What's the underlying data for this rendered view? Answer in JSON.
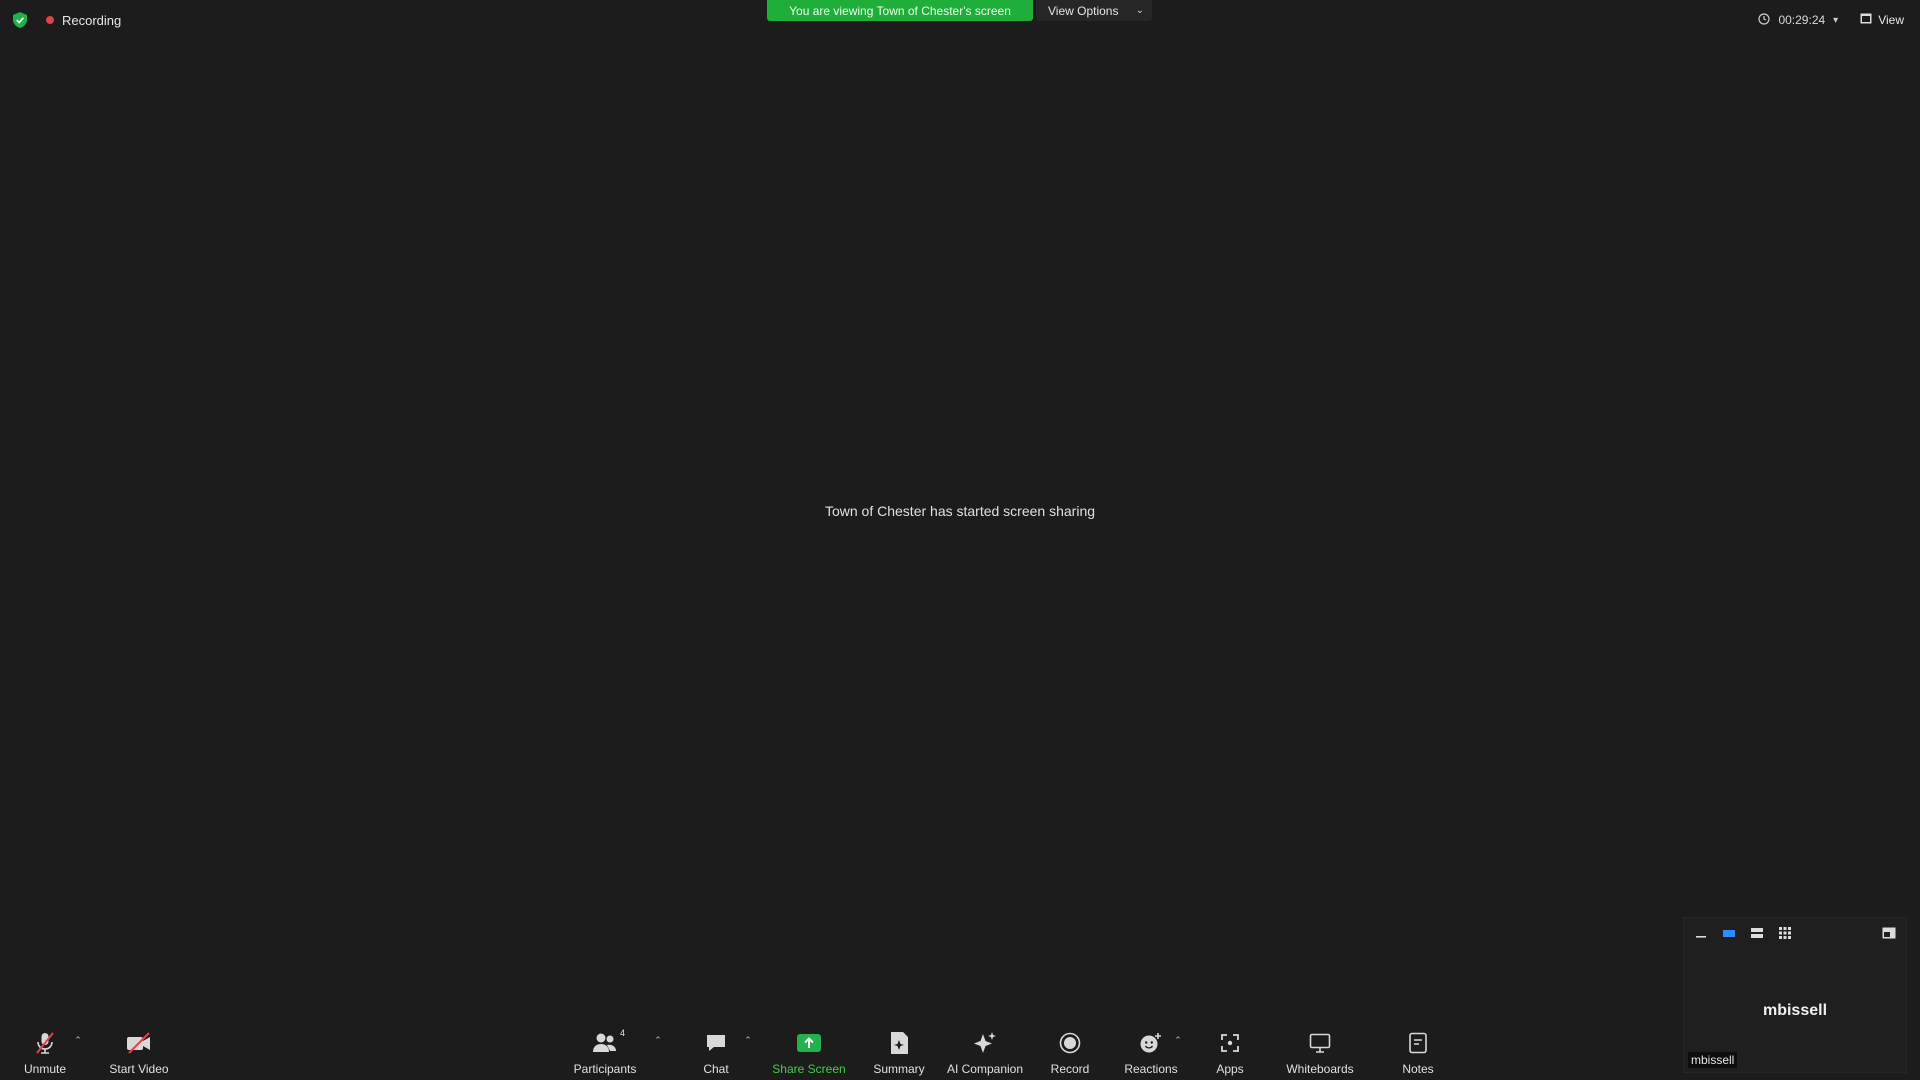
{
  "top_bar": {
    "recording_label": "Recording",
    "banner_text": "You are viewing Town of Chester's screen",
    "view_options_label": "View Options",
    "timer": "00:29:24",
    "view_label": "View"
  },
  "center_message": "Town of Chester has started screen sharing",
  "thumbnail": {
    "name": "mbissell",
    "label": "mbissell"
  },
  "toolbar": {
    "unmute": "Unmute",
    "start_video": "Start Video",
    "participants": "Participants",
    "participants_count": "4",
    "chat": "Chat",
    "share_screen": "Share Screen",
    "summary": "Summary",
    "ai_companion": "AI Companion",
    "record": "Record",
    "reactions": "Reactions",
    "apps": "Apps",
    "whiteboards": "Whiteboards",
    "notes": "Notes"
  },
  "colors": {
    "background": "#1c1c1c",
    "banner_green": "#1fae3a",
    "share_green": "#22b14c",
    "recording_red": "#e0424b",
    "muted_red": "#e0424b",
    "active_blue": "#2d8cff",
    "shield_green": "#22b14c"
  },
  "icons": {
    "shield": "shield-check-icon",
    "recording": "recording-dot-icon",
    "timer": "clock-icon",
    "view": "grid-view-icon",
    "unmute": "microphone-muted-icon",
    "start_video": "camera-off-icon",
    "participants": "people-icon",
    "chat": "chat-bubble-icon",
    "share_screen": "share-screen-icon",
    "summary": "summary-doc-icon",
    "ai_companion": "sparkle-icon",
    "record": "record-icon",
    "reactions": "emoji-plus-icon",
    "apps": "apps-icon",
    "whiteboards": "whiteboard-icon",
    "notes": "notes-icon"
  }
}
